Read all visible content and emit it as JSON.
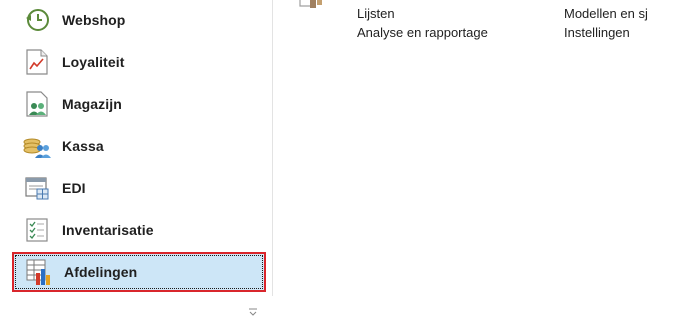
{
  "nav": {
    "items": [
      {
        "label": "Webshop",
        "icon": "webshop-clock-icon"
      },
      {
        "label": "Loyaliteit",
        "icon": "loyalty-chart-icon"
      },
      {
        "label": "Magazijn",
        "icon": "warehouse-icon"
      },
      {
        "label": "Kassa",
        "icon": "cash-register-icon"
      },
      {
        "label": "EDI",
        "icon": "edi-icon"
      },
      {
        "label": "Inventarisatie",
        "icon": "inventory-checklist-icon"
      },
      {
        "label": "Afdelingen",
        "icon": "departments-icon",
        "selected": true
      }
    ],
    "overflow_icon": "chevron-down-icon"
  },
  "content": {
    "links": {
      "lijsten": "Lijsten",
      "analyse": "Analyse en rapportage",
      "modellen": "Modellen en sj",
      "instellingen": "Instellingen"
    }
  },
  "colors": {
    "selected_bg": "#cde6f7",
    "selected_border": "#d9262c"
  }
}
